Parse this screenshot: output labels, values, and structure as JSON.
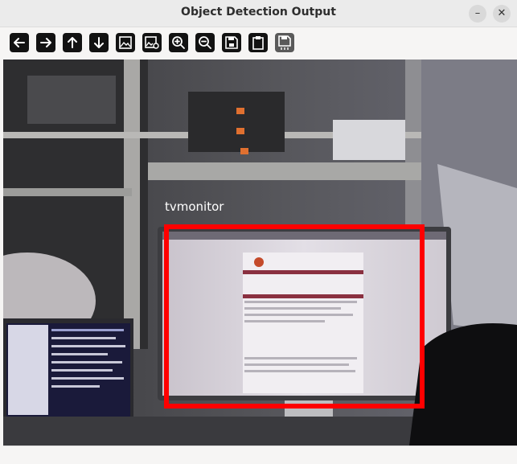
{
  "window": {
    "title": "Object Detection Output",
    "minimize_glyph": "–",
    "close_glyph": "✕"
  },
  "toolbar": {
    "buttons": [
      {
        "name": "back-arrow-icon"
      },
      {
        "name": "forward-arrow-icon"
      },
      {
        "name": "up-arrow-icon"
      },
      {
        "name": "down-arrow-icon"
      },
      {
        "name": "image-icon"
      },
      {
        "name": "image-settings-icon"
      },
      {
        "name": "zoom-in-icon"
      },
      {
        "name": "zoom-out-icon"
      },
      {
        "name": "save-icon"
      },
      {
        "name": "clipboard-icon"
      },
      {
        "name": "save-all-icon"
      }
    ]
  },
  "detection": {
    "label": "tvmonitor",
    "box_color": "#ff0000"
  }
}
